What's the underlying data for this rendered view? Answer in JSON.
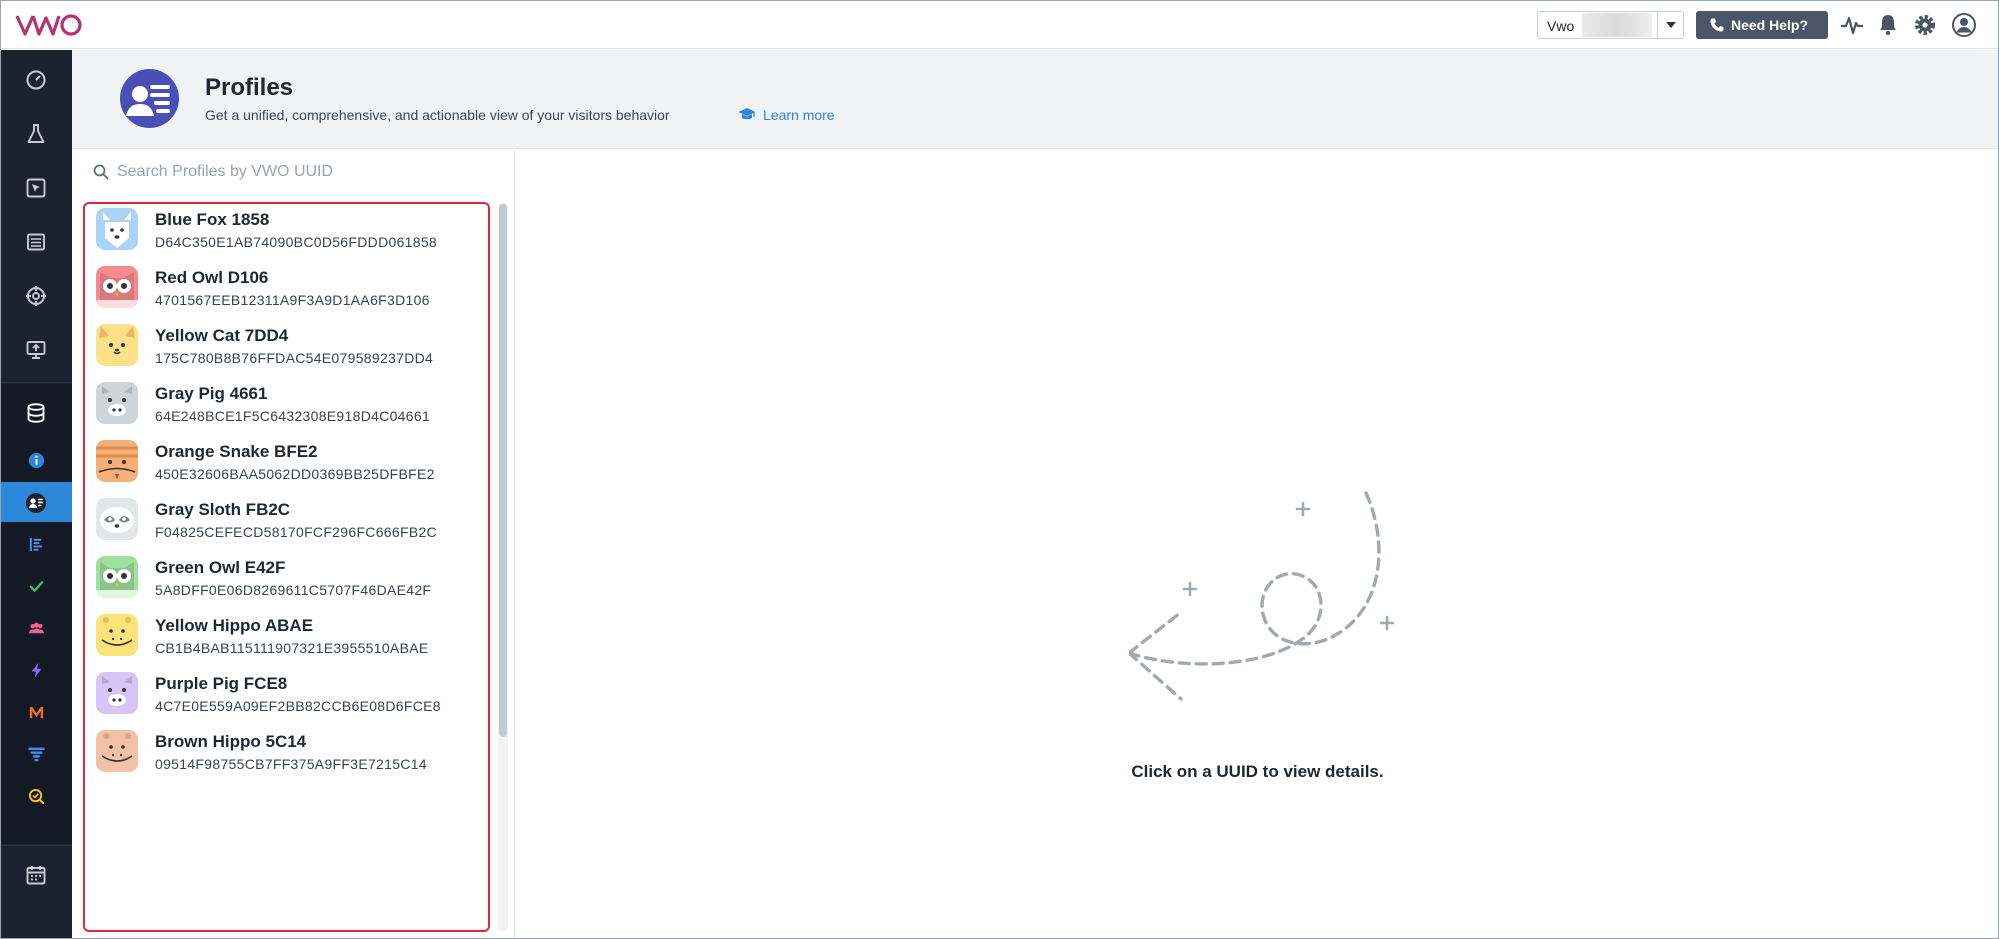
{
  "app": {
    "logo_text": "VWO"
  },
  "topbar": {
    "account_name": "Vwo",
    "help_label": "Need Help?",
    "icons": [
      "pulse-icon",
      "bell-icon",
      "gear-icon",
      "user-avatar-icon"
    ]
  },
  "sidebar": {
    "items": [
      {
        "name": "dashboard-icon"
      },
      {
        "name": "flask-icon"
      },
      {
        "name": "cursor-box-icon"
      },
      {
        "name": "list-icon"
      },
      {
        "name": "crosshair-icon"
      },
      {
        "name": "presentation-icon"
      },
      {
        "name": "database-icon"
      },
      {
        "name": "info-icon"
      },
      {
        "name": "profiles-icon",
        "active": true
      },
      {
        "name": "bar-list-icon"
      },
      {
        "name": "check-icon"
      },
      {
        "name": "users-icon"
      },
      {
        "name": "bolt-icon"
      },
      {
        "name": "m-icon"
      },
      {
        "name": "funnel-icon"
      },
      {
        "name": "search-check-icon"
      },
      {
        "name": "calendar-icon"
      }
    ]
  },
  "header": {
    "title": "Profiles",
    "subtitle": "Get a unified, comprehensive, and actionable view of your visitors behavior",
    "learn_more": "Learn more"
  },
  "search": {
    "placeholder": "Search Profiles by VWO UUID"
  },
  "profiles": [
    {
      "name": "Blue Fox 1858",
      "uuid": "D64C350E1AB74090BC0D56FDDD061858",
      "animal": "fox",
      "color": "#a9d4f7"
    },
    {
      "name": "Red Owl D106",
      "uuid": "4701567EEB12311A9F3A9D1AA6F3D106",
      "animal": "owl",
      "color": "#f58a8f"
    },
    {
      "name": "Yellow Cat 7DD4",
      "uuid": "175C780B8B76FFDAC54E079589237DD4",
      "animal": "cat",
      "color": "#fde08a"
    },
    {
      "name": "Gray Pig 4661",
      "uuid": "64E248BCE1F5C6432308E918D4C04661",
      "animal": "pig",
      "color": "#cfd4d9"
    },
    {
      "name": "Orange Snake BFE2",
      "uuid": "450E32606BAA5062DD0369BB25DFBFE2",
      "animal": "snake",
      "color": "#f5b07a"
    },
    {
      "name": "Gray Sloth FB2C",
      "uuid": "F04825CEFECD58170FCF296FC666FB2C",
      "animal": "sloth",
      "color": "#e3e6e9"
    },
    {
      "name": "Green Owl E42F",
      "uuid": "5A8DFF0E06D8269611C5707F46DAE42F",
      "animal": "owl",
      "color": "#9ee09d"
    },
    {
      "name": "Yellow Hippo ABAE",
      "uuid": "CB1B4BAB115111907321E3955510ABAE",
      "animal": "hippo",
      "color": "#fde37a"
    },
    {
      "name": "Purple Pig FCE8",
      "uuid": "4C7E0E559A09EF2BB82CCB6E08D6FCE8",
      "animal": "pig",
      "color": "#d7c6f5"
    },
    {
      "name": "Brown Hippo 5C14",
      "uuid": "09514F98755CB7FF375A9FF3E7215C14",
      "animal": "hippo",
      "color": "#f3c2a6"
    }
  ],
  "detail": {
    "empty_message": "Click on a UUID to view details."
  }
}
